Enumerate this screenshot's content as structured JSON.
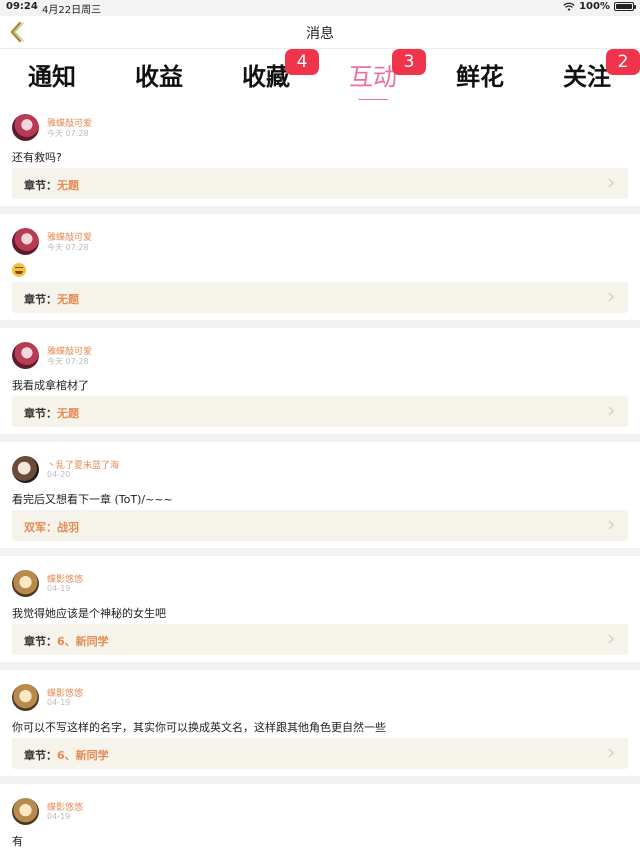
{
  "status_bar": {
    "time": "09:24",
    "date": "4月22日周三",
    "battery": "100%",
    "battery_level": 1.0
  },
  "nav": {
    "title": "消息",
    "back_icon": "chevron-left-icon"
  },
  "tabs": [
    {
      "label": "通知",
      "badge": ""
    },
    {
      "label": "收益",
      "badge": ""
    },
    {
      "label": "收藏",
      "badge": "4"
    },
    {
      "label": "互动",
      "badge": "3",
      "active": true
    },
    {
      "label": "鲜花",
      "badge": ""
    },
    {
      "label": "关注",
      "badge": "2"
    }
  ],
  "colors": {
    "accent": "#ec6f9c",
    "badge": "#f0344c",
    "username": "#e58b55",
    "chapter_bg": "#f5f3ea"
  },
  "messages": [
    {
      "username": "雅蝶敲可爱",
      "time": "今天 07:28",
      "content": "还有救吗?",
      "chapter_label": "章节：",
      "chapter_value": "无题"
    },
    {
      "username": "雅蝶敲可爱",
      "time": "今天 07:28",
      "content": "",
      "content_icon": "laughing-emoji-icon",
      "chapter_label": "章节：",
      "chapter_value": "无题"
    },
    {
      "username": "雅蝶敲可爱",
      "time": "今天 07:28",
      "content": "我看成拿棺材了",
      "chapter_label": "章节：",
      "chapter_value": "无题"
    },
    {
      "username": "丶乱了夏末蓝了海",
      "time": "04-20",
      "content": "看完后又想看下一章 (ToT)/~~~",
      "chapter_label": "双军：",
      "chapter_value": "战羽"
    },
    {
      "username": "蝶影悠悠",
      "time": "04-19",
      "content": "我觉得她应该是个神秘的女生吧",
      "chapter_label": "章节：",
      "chapter_value": "6、新同学"
    },
    {
      "username": "蝶影悠悠",
      "time": "04-19",
      "content": "你可以不写这样的名字，其实你可以换成英文名，这样跟其他角色更自然一些",
      "chapter_label": "章节：",
      "chapter_value": "6、新同学"
    },
    {
      "username": "蝶影悠悠",
      "time": "04-19",
      "content": "有",
      "chapter_label": "",
      "chapter_value": ""
    }
  ]
}
